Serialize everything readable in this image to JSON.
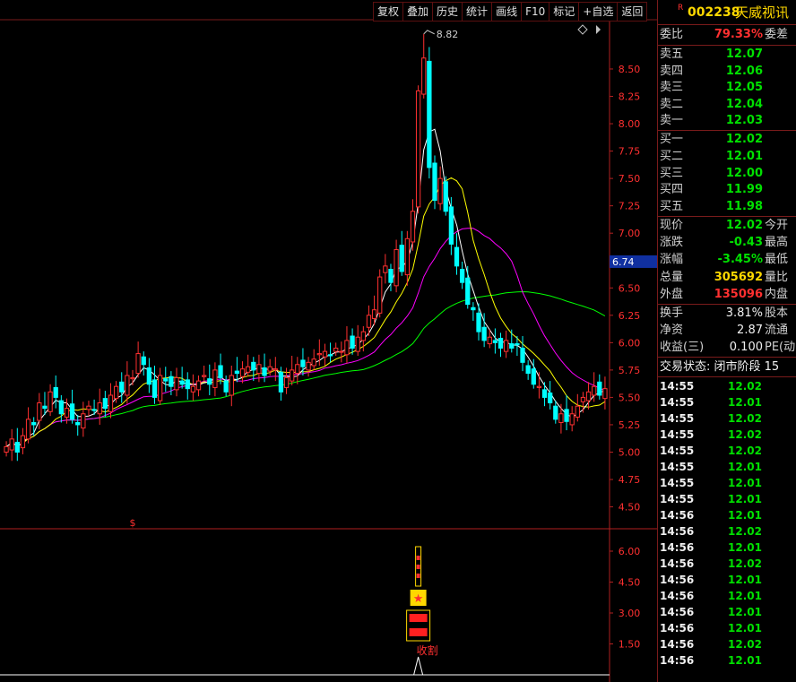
{
  "toolbar": [
    "复权",
    "叠加",
    "历史",
    "统计",
    "画线",
    "F10",
    "标记",
    "+自选",
    "返回"
  ],
  "stock": {
    "badge": "R",
    "code": "002238",
    "name": "天威视讯"
  },
  "weibi": {
    "label": "委比",
    "value": "79.33%",
    "tail": "委差"
  },
  "asks": [
    {
      "label": "卖五",
      "price": "12.07"
    },
    {
      "label": "卖四",
      "price": "12.06"
    },
    {
      "label": "卖三",
      "price": "12.05"
    },
    {
      "label": "卖二",
      "price": "12.04"
    },
    {
      "label": "卖一",
      "price": "12.03"
    }
  ],
  "bids": [
    {
      "label": "买一",
      "price": "12.02"
    },
    {
      "label": "买二",
      "price": "12.01"
    },
    {
      "label": "买三",
      "price": "12.00"
    },
    {
      "label": "买四",
      "price": "11.99"
    },
    {
      "label": "买五",
      "price": "11.98"
    }
  ],
  "quote": [
    {
      "label": "现价",
      "value": "12.02",
      "tail": "今开",
      "color": "green"
    },
    {
      "label": "涨跌",
      "value": "-0.43",
      "tail": "最高",
      "color": "green"
    },
    {
      "label": "涨幅",
      "value": "-3.45%",
      "tail": "最低",
      "color": "green"
    },
    {
      "label": "总量",
      "value": "305692",
      "tail": "量比",
      "color": "yellow"
    },
    {
      "label": "外盘",
      "value": "135096",
      "tail": "内盘",
      "color": "red"
    }
  ],
  "stats": [
    {
      "label": "换手",
      "value": "3.81%",
      "tail": "股本"
    },
    {
      "label": "净资",
      "value": "2.87",
      "tail": "流通"
    },
    {
      "label": "收益(三)",
      "value": "0.100",
      "tail": "PE(动"
    }
  ],
  "status": "交易状态: 闭市阶段 15",
  "ticks": [
    {
      "time": "14:55",
      "price": "12.02",
      "color": "green"
    },
    {
      "time": "14:55",
      "price": "12.01",
      "color": "green"
    },
    {
      "time": "14:55",
      "price": "12.02",
      "color": "green"
    },
    {
      "time": "14:55",
      "price": "12.02",
      "color": "green"
    },
    {
      "time": "14:55",
      "price": "12.02",
      "color": "green"
    },
    {
      "time": "14:55",
      "price": "12.01",
      "color": "green"
    },
    {
      "time": "14:55",
      "price": "12.01",
      "color": "green"
    },
    {
      "time": "14:55",
      "price": "12.01",
      "color": "green"
    },
    {
      "time": "14:56",
      "price": "12.01",
      "color": "green"
    },
    {
      "time": "14:56",
      "price": "12.02",
      "color": "green"
    },
    {
      "time": "14:56",
      "price": "12.01",
      "color": "green"
    },
    {
      "time": "14:56",
      "price": "12.02",
      "color": "green"
    },
    {
      "time": "14:56",
      "price": "12.01",
      "color": "green"
    },
    {
      "time": "14:56",
      "price": "12.01",
      "color": "green"
    },
    {
      "time": "14:56",
      "price": "12.01",
      "color": "green"
    },
    {
      "time": "14:56",
      "price": "12.01",
      "color": "green"
    },
    {
      "time": "14:56",
      "price": "12.02",
      "color": "green"
    },
    {
      "time": "14:56",
      "price": "12.01",
      "color": "green"
    }
  ],
  "chart_data": {
    "type": "candlestick",
    "ylim": [
      4.3,
      8.95
    ],
    "yticks": [
      "8.50",
      "8.25",
      "8.00",
      "7.75",
      "7.50",
      "7.25",
      "7.00",
      "6.75",
      "6.50",
      "6.25",
      "6.00",
      "5.75",
      "5.50",
      "5.25",
      "5.00",
      "4.75",
      "4.50"
    ],
    "peak_label": "8.82",
    "cursor_label": "6.74",
    "marker_label": "$",
    "bottom_yticks": [
      "6.00",
      "4.50",
      "3.00",
      "1.50"
    ],
    "signal_label": "收割",
    "colors": {
      "up": "#ff3030",
      "down": "#00ffff",
      "ma5": "#ffffff",
      "ma10": "#ffff00",
      "ma20": "#ff00ff",
      "ma60": "#00ff00"
    },
    "closes": [
      5.05,
      5.12,
      5.0,
      5.15,
      5.3,
      5.25,
      5.45,
      5.4,
      5.55,
      5.5,
      5.35,
      5.4,
      5.3,
      5.25,
      5.35,
      5.42,
      5.38,
      5.45,
      5.4,
      5.52,
      5.6,
      5.55,
      5.7,
      5.68,
      5.9,
      5.8,
      5.62,
      5.5,
      5.7,
      5.65,
      5.6,
      5.68,
      5.62,
      5.58,
      5.6,
      5.65,
      5.7,
      5.62,
      5.75,
      5.68,
      5.55,
      5.7,
      5.72,
      5.76,
      5.78,
      5.75,
      5.8,
      5.7,
      5.78,
      5.76,
      5.55,
      5.68,
      5.75,
      5.8,
      5.78,
      5.82,
      5.85,
      5.9,
      5.92,
      5.88,
      5.95,
      5.92,
      6.02,
      5.95,
      6.05,
      6.1,
      6.25,
      6.3,
      6.6,
      6.7,
      6.55,
      6.85,
      6.65,
      6.95,
      7.2,
      8.3,
      8.6,
      7.6,
      7.3,
      7.5,
      7.2,
      6.9,
      6.7,
      6.55,
      6.35,
      6.3,
      6.1,
      6.02,
      6.05,
      6.0,
      5.95,
      6.02,
      5.95,
      5.98,
      5.82,
      5.72,
      5.62,
      5.6,
      5.5,
      5.45,
      5.3,
      5.35,
      5.28,
      5.35,
      5.42,
      5.5,
      5.55,
      5.6,
      5.52,
      5.58
    ]
  }
}
